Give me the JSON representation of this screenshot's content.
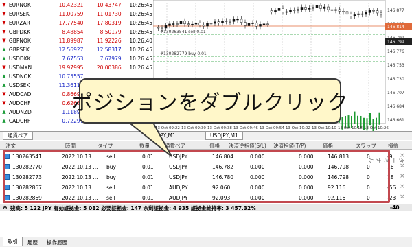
{
  "market_watch": {
    "rows": [
      {
        "symbol": "EURNOK",
        "bid": "10.42321",
        "ask": "10.43747",
        "time": "10:26:45",
        "dir": "down",
        "color": "red"
      },
      {
        "symbol": "EURSEK",
        "bid": "11.00759",
        "ask": "11.01730",
        "time": "10:26:45",
        "dir": "down",
        "color": "red"
      },
      {
        "symbol": "EURZAR",
        "bid": "17.77540",
        "ask": "17.80319",
        "time": "10:26:45",
        "dir": "down",
        "color": "red"
      },
      {
        "symbol": "GBPDKK",
        "bid": "8.48854",
        "ask": "8.50179",
        "time": "10:26:45",
        "dir": "down",
        "color": "red"
      },
      {
        "symbol": "GBPNOK",
        "bid": "11.89987",
        "ask": "11.92226",
        "time": "10:26:40",
        "dir": "down",
        "color": "red"
      },
      {
        "symbol": "GBPSEK",
        "bid": "12.56927",
        "ask": "12.58317",
        "time": "10:26:45",
        "dir": "up",
        "color": "blue"
      },
      {
        "symbol": "USDDKK",
        "bid": "7.67553",
        "ask": "7.67979",
        "time": "10:26:45",
        "dir": "up",
        "color": "blue"
      },
      {
        "symbol": "USDMXN",
        "bid": "19.97995",
        "ask": "20.00386",
        "time": "10:26:45",
        "dir": "down",
        "color": "red"
      },
      {
        "symbol": "USDNOK",
        "bid": "10.75557",
        "ask": "",
        "time": "",
        "dir": "up",
        "color": "blue"
      },
      {
        "symbol": "USDSEK",
        "bid": "11.36118",
        "ask": "",
        "time": "",
        "dir": "up",
        "color": "blue"
      },
      {
        "symbol": "AUDCAD",
        "bid": "0.86697",
        "ask": "",
        "time": "",
        "dir": "down",
        "color": "red"
      },
      {
        "symbol": "AUDCHF",
        "bid": "0.62683",
        "ask": "",
        "time": "",
        "dir": "down",
        "color": "red"
      },
      {
        "symbol": "AUDNZD",
        "bid": "1.11898",
        "ask": "",
        "time": "",
        "dir": "up",
        "color": "blue"
      },
      {
        "symbol": "CADCHF",
        "bid": "0.72297",
        "ask": "0.72334",
        "time": "10:26:45",
        "dir": "up",
        "color": "blue"
      }
    ],
    "tab_label": "通貨ペア"
  },
  "chart": {
    "price_labels": [
      "146.877",
      "146.832",
      "146.799",
      "146.776",
      "146.753",
      "146.730",
      "146.707",
      "146.684",
      "146.661"
    ],
    "highlight_prices": {
      "red": "146.814",
      "dark": "146.799"
    },
    "order_labels": {
      "sell": "#130263541 sell 0.01",
      "buy": "#130282779 buy 0.01"
    },
    "time_labels": [
      "13 Oct 09:22",
      "13 Oct 09:30",
      "13 Oct 09:38",
      "13 Oct 09:46",
      "13 Oct 09:54",
      "13 Oct 10:02",
      "13 Oct 10:10",
      "13 Oct 10:18",
      "13 Oct 10:26"
    ],
    "tabs": [
      "JPY,M1",
      "USDJPY,M1"
    ]
  },
  "terminal": {
    "columns": [
      "注文",
      "時間",
      "タイプ",
      "数量",
      "通貨ペア",
      "価格",
      "決済逆指値(S/L)",
      "決済指値(T/P)",
      "価格",
      "スワップ",
      "損益"
    ],
    "rows": [
      {
        "ticket": "130263541",
        "time": "2022.10.13 ...",
        "type": "sell",
        "volume": "0.01",
        "symbol": "USDJPY",
        "price": "146.804",
        "sl": "0.000",
        "tp": "0.000",
        "cur": "146.813",
        "swap": "0",
        "profit": "-9"
      },
      {
        "ticket": "130282770",
        "time": "2022.10.13 ...",
        "type": "buy",
        "volume": "0.01",
        "symbol": "USDJPY",
        "price": "146.782",
        "sl": "0.000",
        "tp": "0.000",
        "cur": "146.798",
        "swap": "0",
        "profit": "16"
      },
      {
        "ticket": "130282773",
        "time": "2022.10.13 ...",
        "type": "buy",
        "volume": "0.01",
        "symbol": "USDJPY",
        "price": "146.780",
        "sl": "0.000",
        "tp": "0.000",
        "cur": "146.798",
        "swap": "0",
        "profit": "18"
      },
      {
        "ticket": "130282867",
        "time": "2022.10.13 ...",
        "type": "sell",
        "volume": "0.01",
        "symbol": "AUDJPY",
        "price": "92.060",
        "sl": "0.000",
        "tp": "0.000",
        "cur": "92.116",
        "swap": "0",
        "profit": "-56"
      },
      {
        "ticket": "130282869",
        "time": "2022.10.13 ...",
        "type": "sell",
        "volume": "0.01",
        "symbol": "AUDJPY",
        "price": "92.093",
        "sl": "0.000",
        "tp": "0.000",
        "cur": "92.116",
        "swap": "0",
        "profit": "-23"
      }
    ],
    "summary": "残高: 5 122 JPY  有効証拠金: 5 082  必要証拠金: 147  余剰証拠金: 4 935  証拠金維持率: 3 457.32%",
    "summary_profit": "-40",
    "bottom_tabs": [
      "取引",
      "履歴",
      "操作履歴"
    ],
    "side_label": "ターミナル"
  },
  "callout": {
    "text": "ポジションをダブルクリック"
  },
  "colors": {
    "highlight_border": "#c2484f",
    "bubble_fill": "#fff7c9",
    "bid_down": "#d00000",
    "bid_up": "#1a28c8"
  }
}
